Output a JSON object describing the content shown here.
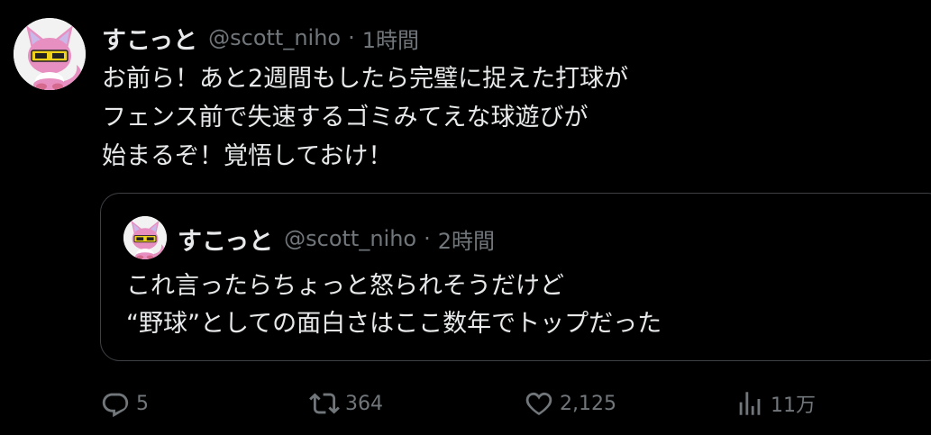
{
  "tweet": {
    "author_name": "すこっと",
    "author_handle": "@scott_niho",
    "separator": "·",
    "time": "1時間",
    "text_lines": [
      "お前ら！あと2週間もしたら完璧に捉えた打球が",
      "フェンス前で失速するゴミみてえな球遊びが",
      "始まるぞ！覚悟しておけ！"
    ]
  },
  "quoted": {
    "author_name": "すこっと",
    "author_handle": "@scott_niho",
    "separator": "·",
    "time": "2時間",
    "text_lines": [
      "これ言ったらちょっと怒られそうだけど",
      "“野球”としての面白さはここ数年でトップだった"
    ]
  },
  "actions": {
    "reply": {
      "icon": "reply-icon",
      "count": "5"
    },
    "retweet": {
      "icon": "retweet-icon",
      "count": "364"
    },
    "like": {
      "icon": "heart-icon",
      "count": "2,125"
    },
    "views": {
      "icon": "views-icon",
      "count": "11万"
    }
  },
  "colors": {
    "background": "#000000",
    "text": "#e7e9ea",
    "secondary": "#71767b",
    "border": "#3e4144",
    "avatar_pink": "#e78fc0",
    "avatar_glasses": "#f0d21a"
  }
}
